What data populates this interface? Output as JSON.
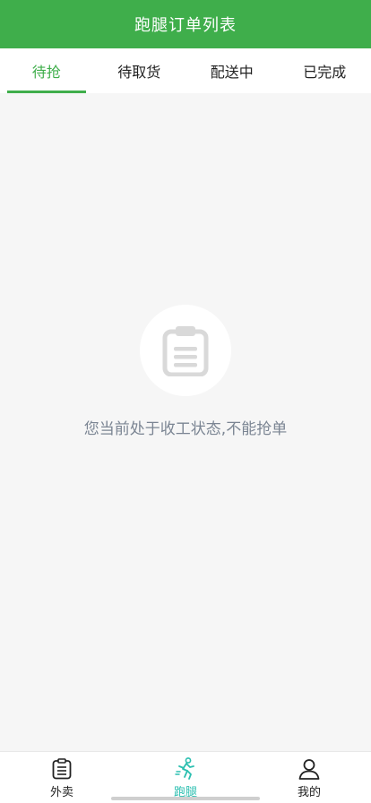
{
  "header": {
    "title": "跑腿订单列表"
  },
  "tabs": [
    {
      "label": "待抢",
      "active": true
    },
    {
      "label": "待取货",
      "active": false
    },
    {
      "label": "配送中",
      "active": false
    },
    {
      "label": "已完成",
      "active": false
    }
  ],
  "empty_state": {
    "icon": "clipboard-icon",
    "message": "您当前处于收工状态,不能抢单"
  },
  "bottom_nav": [
    {
      "label": "外卖",
      "icon": "takeout-list-icon",
      "active": false
    },
    {
      "label": "跑腿",
      "icon": "runner-icon",
      "active": true
    },
    {
      "label": "我的",
      "icon": "user-icon",
      "active": false
    }
  ],
  "colors": {
    "brand_green": "#3fae4b",
    "active_nav_teal": "#2bbfb0",
    "empty_text_gray": "#7b8593"
  }
}
